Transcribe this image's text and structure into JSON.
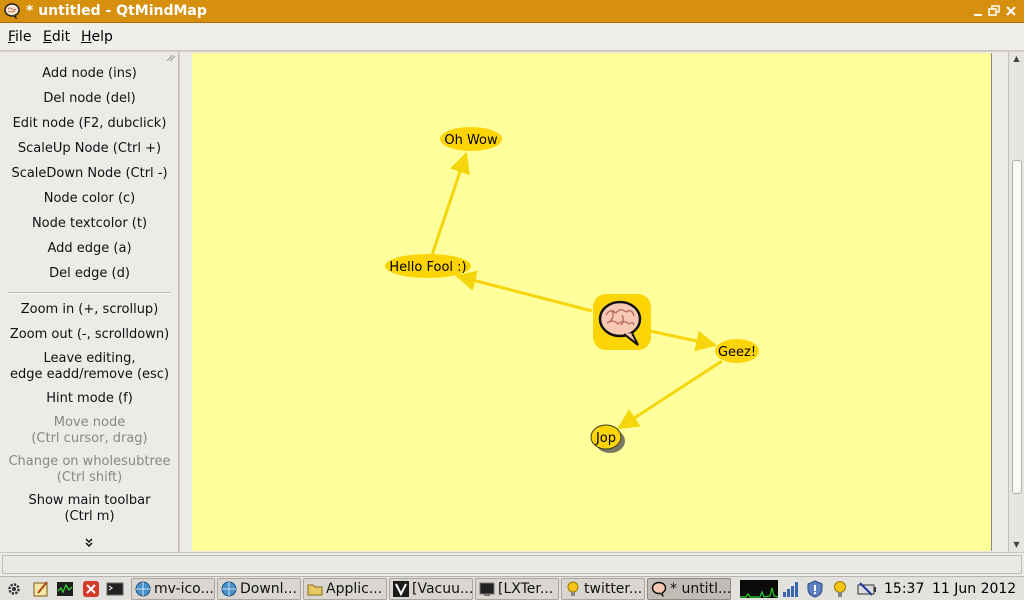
{
  "window": {
    "title": "* untitled - QtMindMap",
    "controls": [
      "minimize",
      "maximize",
      "close"
    ]
  },
  "menubar": {
    "items": [
      {
        "label": "File",
        "mnemonic": "F"
      },
      {
        "label": "Edit",
        "mnemonic": "E"
      },
      {
        "label": "Help",
        "mnemonic": "H"
      }
    ]
  },
  "toolbar": {
    "group1": [
      {
        "label": "Add node (ins)",
        "enabled": true
      },
      {
        "label": "Del node (del)",
        "enabled": true
      },
      {
        "label": "Edit node (F2, dubclick)",
        "enabled": true
      },
      {
        "label": "ScaleUp Node (Ctrl +)",
        "enabled": true
      },
      {
        "label": "ScaleDown Node (Ctrl -)",
        "enabled": true
      },
      {
        "label": "Node color (c)",
        "enabled": true
      },
      {
        "label": "Node textcolor (t)",
        "enabled": true
      },
      {
        "label": "Add edge (a)",
        "enabled": true
      },
      {
        "label": "Del edge (d)",
        "enabled": true
      }
    ],
    "group2": [
      {
        "line1": "Zoom in (+, scrollup)",
        "line2": "",
        "enabled": true
      },
      {
        "line1": "Zoom out (-, scrolldown)",
        "line2": "",
        "enabled": true
      },
      {
        "line1": "Leave editing,",
        "line2": "edge eadd/remove (esc)",
        "enabled": true
      },
      {
        "line1": "Hint mode (f)",
        "line2": "",
        "enabled": true
      },
      {
        "line1": "Move node",
        "line2": "(Ctrl cursor, drag)",
        "enabled": false
      },
      {
        "line1": "Change on wholesubtree",
        "line2": "(Ctrl shift)",
        "enabled": false
      },
      {
        "line1": "Show main toolbar",
        "line2": "(Ctrl m)",
        "enabled": true
      }
    ],
    "overflow_icon": "double-chevron-down-icon"
  },
  "mindmap": {
    "background": "#ffff9c",
    "node_color": "#fdd406",
    "edge_color": "#f5d60c",
    "nodes": [
      {
        "id": "root",
        "label": "",
        "icon": "brain-speech-bubble-icon"
      },
      {
        "id": "hello",
        "label": "Hello Fool :)"
      },
      {
        "id": "ohwow",
        "label": "Oh Wow"
      },
      {
        "id": "geez",
        "label": "Geez!"
      },
      {
        "id": "jop",
        "label": "Jop",
        "selected": true
      }
    ],
    "edges": [
      {
        "from": "root",
        "to": "hello"
      },
      {
        "from": "hello",
        "to": "ohwow"
      },
      {
        "from": "root",
        "to": "geez"
      },
      {
        "from": "geez",
        "to": "jop"
      }
    ]
  },
  "taskbar": {
    "launchers": [
      "settings-gear-icon",
      "text-editor-icon",
      "system-monitor-icon",
      "pdf-reader-icon",
      "terminal-launcher-icon"
    ],
    "tasks": [
      {
        "label": "mv-ico...",
        "icon": "browser-icon",
        "active": false
      },
      {
        "label": "Downl...",
        "icon": "browser-icon",
        "active": false
      },
      {
        "label": "Applic...",
        "icon": "folder-icon",
        "active": false
      },
      {
        "label": "[Vacuu...",
        "icon": "vim-icon",
        "active": false
      },
      {
        "label": "[LXTer...",
        "icon": "terminal-icon",
        "active": false
      },
      {
        "label": "twitter...",
        "icon": "lightbulb-icon",
        "active": false
      },
      {
        "label": "* untitl...",
        "icon": "qtmindmap-icon",
        "active": true
      }
    ],
    "tray": [
      "cpu-graph-icon",
      "network-signal-icon",
      "shield-icon",
      "lightbulb-icon",
      "battery-plug-icon"
    ],
    "time": "15:37",
    "date": "11 Jun 2012"
  }
}
